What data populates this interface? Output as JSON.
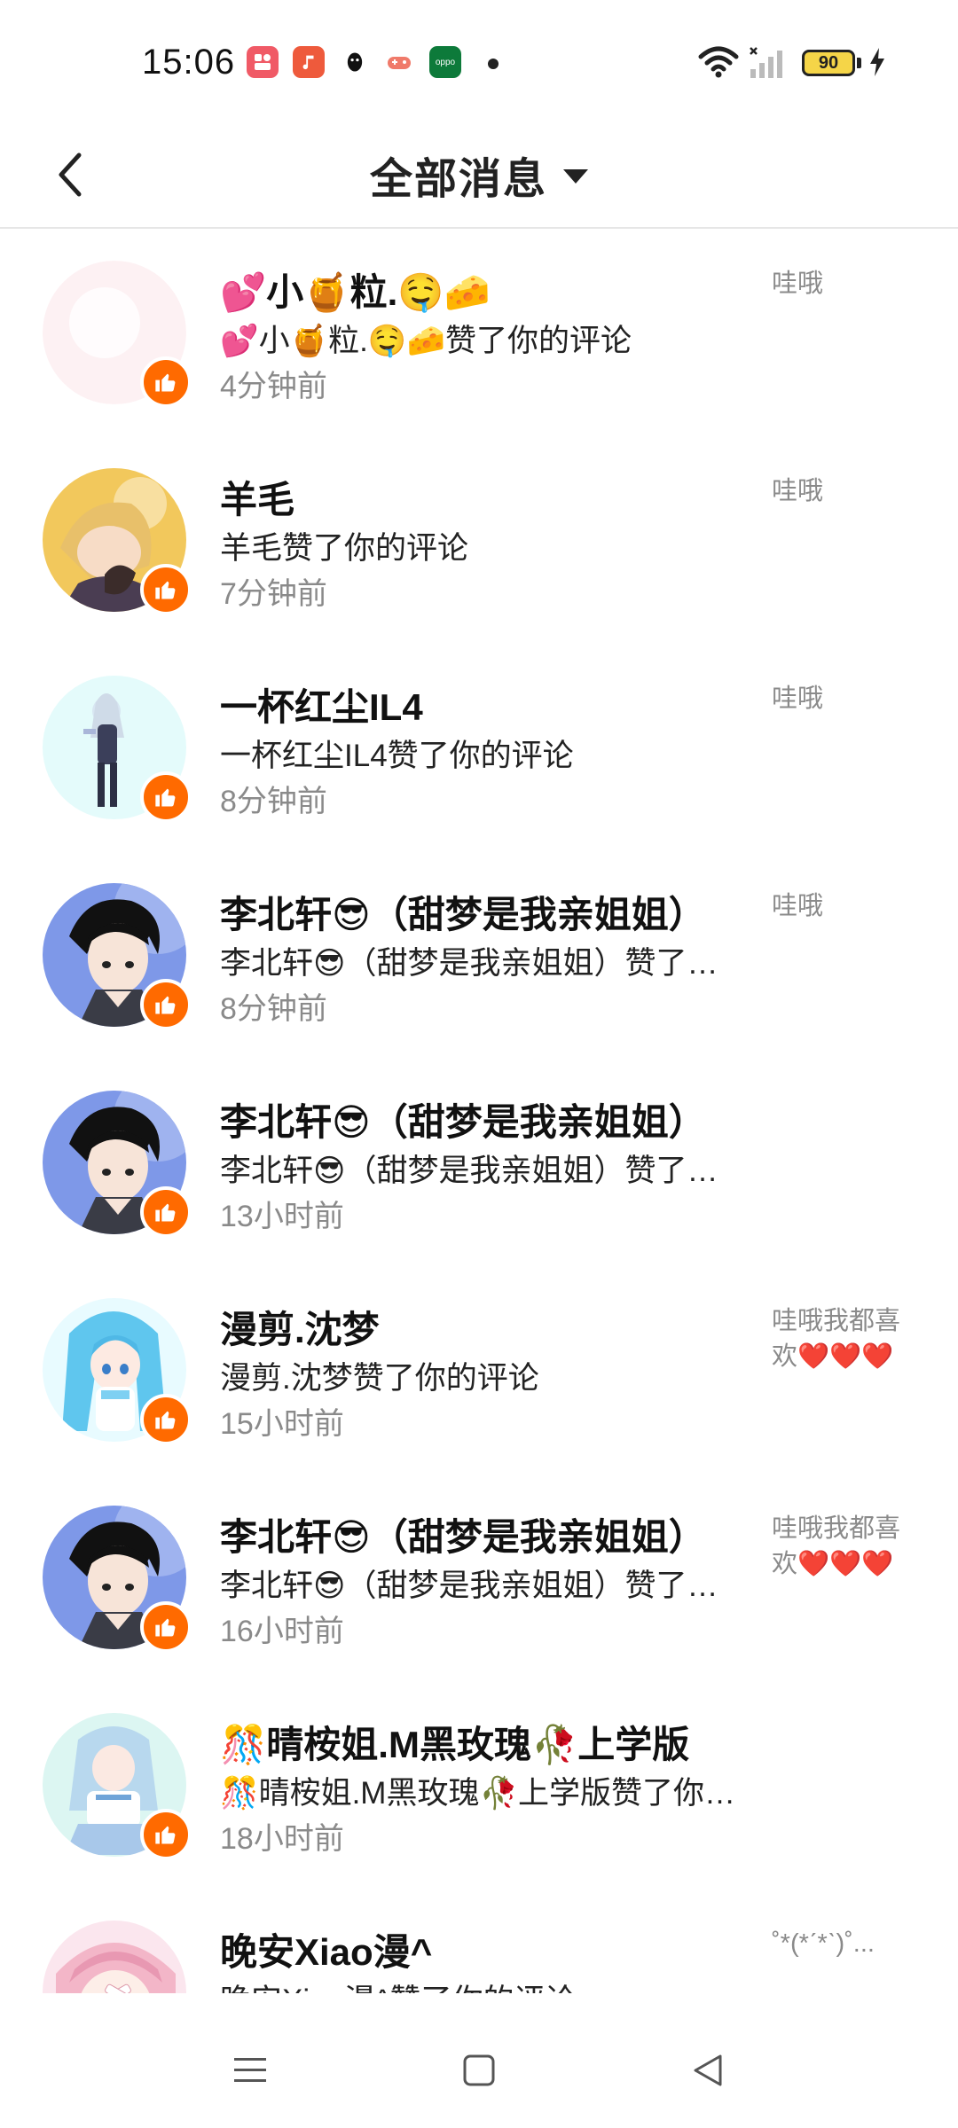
{
  "status_bar": {
    "time": "15:06",
    "battery": "90",
    "app_icons": [
      {
        "name": "kuaishou-app-icon",
        "color": "#f0505a",
        "glyph": "◉"
      },
      {
        "name": "douyin-app-icon",
        "color": "#f25a3c",
        "glyph": "♪"
      },
      {
        "name": "qq-app-icon",
        "color": "#ffffff",
        "glyph": "●"
      },
      {
        "name": "game-app-icon",
        "color": "#ffffff",
        "glyph": "🎮"
      },
      {
        "name": "oppo-app-icon",
        "color": "#0d7a3a",
        "glyph": "oppo"
      }
    ]
  },
  "header": {
    "title": "全部消息"
  },
  "messages": [
    {
      "name": "💕小🍯粒.🤤🧀",
      "desc": "💕小🍯粒.🤤🧀赞了你的评论",
      "time": "4分钟前",
      "comment": "哇哦",
      "avatar": "blank"
    },
    {
      "name": "羊毛",
      "desc": "羊毛赞了你的评论",
      "time": "7分钟前",
      "comment": "哇哦",
      "avatar": "blonde"
    },
    {
      "name": "一杯红尘IL4",
      "desc": "一杯红尘IL4赞了你的评论",
      "time": "8分钟前",
      "comment": "哇哦",
      "avatar": "chibi"
    },
    {
      "name": "李北轩😎（甜梦是我亲姐姐）",
      "desc": "李北轩😎（甜梦是我亲姐姐）赞了你的评论",
      "time": "8分钟前",
      "comment": "哇哦",
      "avatar": "boy"
    },
    {
      "name": "李北轩😎（甜梦是我亲姐姐）",
      "desc": "李北轩😎（甜梦是我亲姐姐）赞了你的评论",
      "time": "13小时前",
      "comment": "",
      "avatar": "boy"
    },
    {
      "name": "漫剪.沈梦",
      "desc": "漫剪.沈梦赞了你的评论",
      "time": "15小时前",
      "comment": "哇哦我都喜欢❤️❤️❤️",
      "avatar": "bluegirl"
    },
    {
      "name": "李北轩😎（甜梦是我亲姐姐）",
      "desc": "李北轩😎（甜梦是我亲姐姐）赞了你的评论",
      "time": "16小时前",
      "comment": "哇哦我都喜欢❤️❤️❤️",
      "avatar": "boy"
    },
    {
      "name": "🎊晴桉姐.M黑玫瑰🥀上学版",
      "desc": "🎊晴桉姐.M黑玫瑰🥀上学版赞了你的评论",
      "time": "18小时前",
      "comment": "",
      "avatar": "maid"
    },
    {
      "name": "晚安Xiao漫^",
      "desc": "晚安Xiao漫^赞了你的评论",
      "time": "",
      "comment": "˚*(*ˊ*ˋ)˚...",
      "avatar": "pink"
    }
  ],
  "colors": {
    "accent": "#ff6a00",
    "secondary_text": "#8a8a8a"
  }
}
